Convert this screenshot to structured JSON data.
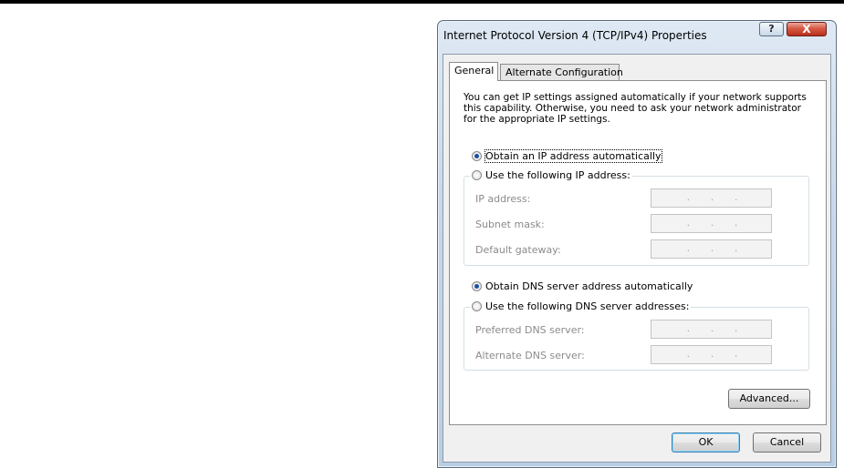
{
  "dialog": {
    "title": "Internet Protocol Version 4 (TCP/IPv4) Properties",
    "help_label": "?",
    "close_label": "X"
  },
  "tabs": [
    {
      "label": "General",
      "active": true
    },
    {
      "label": "Alternate Configuration",
      "active": false
    }
  ],
  "description": "You can get IP settings assigned automatically if your network supports this capability. Otherwise, you need to ask your network administrator for the appropriate IP settings.",
  "ip": {
    "auto_label": "Obtain an IP address automatically",
    "manual_label": "Use the following IP address:",
    "auto_selected": true,
    "fields": [
      {
        "label": "IP address:",
        "value": ". . ."
      },
      {
        "label": "Subnet mask:",
        "value": ". . ."
      },
      {
        "label": "Default gateway:",
        "value": ". . ."
      }
    ]
  },
  "dns": {
    "auto_label": "Obtain DNS server address automatically",
    "manual_label": "Use the following DNS server addresses:",
    "auto_selected": true,
    "fields": [
      {
        "label": "Preferred DNS server:",
        "value": ". . ."
      },
      {
        "label": "Alternate DNS server:",
        "value": ". . ."
      }
    ]
  },
  "buttons": {
    "advanced": "Advanced...",
    "ok": "OK",
    "cancel": "Cancel"
  },
  "colors": {
    "accent": "#1d4fa0",
    "close_button": "#c8412b",
    "disabled_text": "#8b8b8b"
  }
}
